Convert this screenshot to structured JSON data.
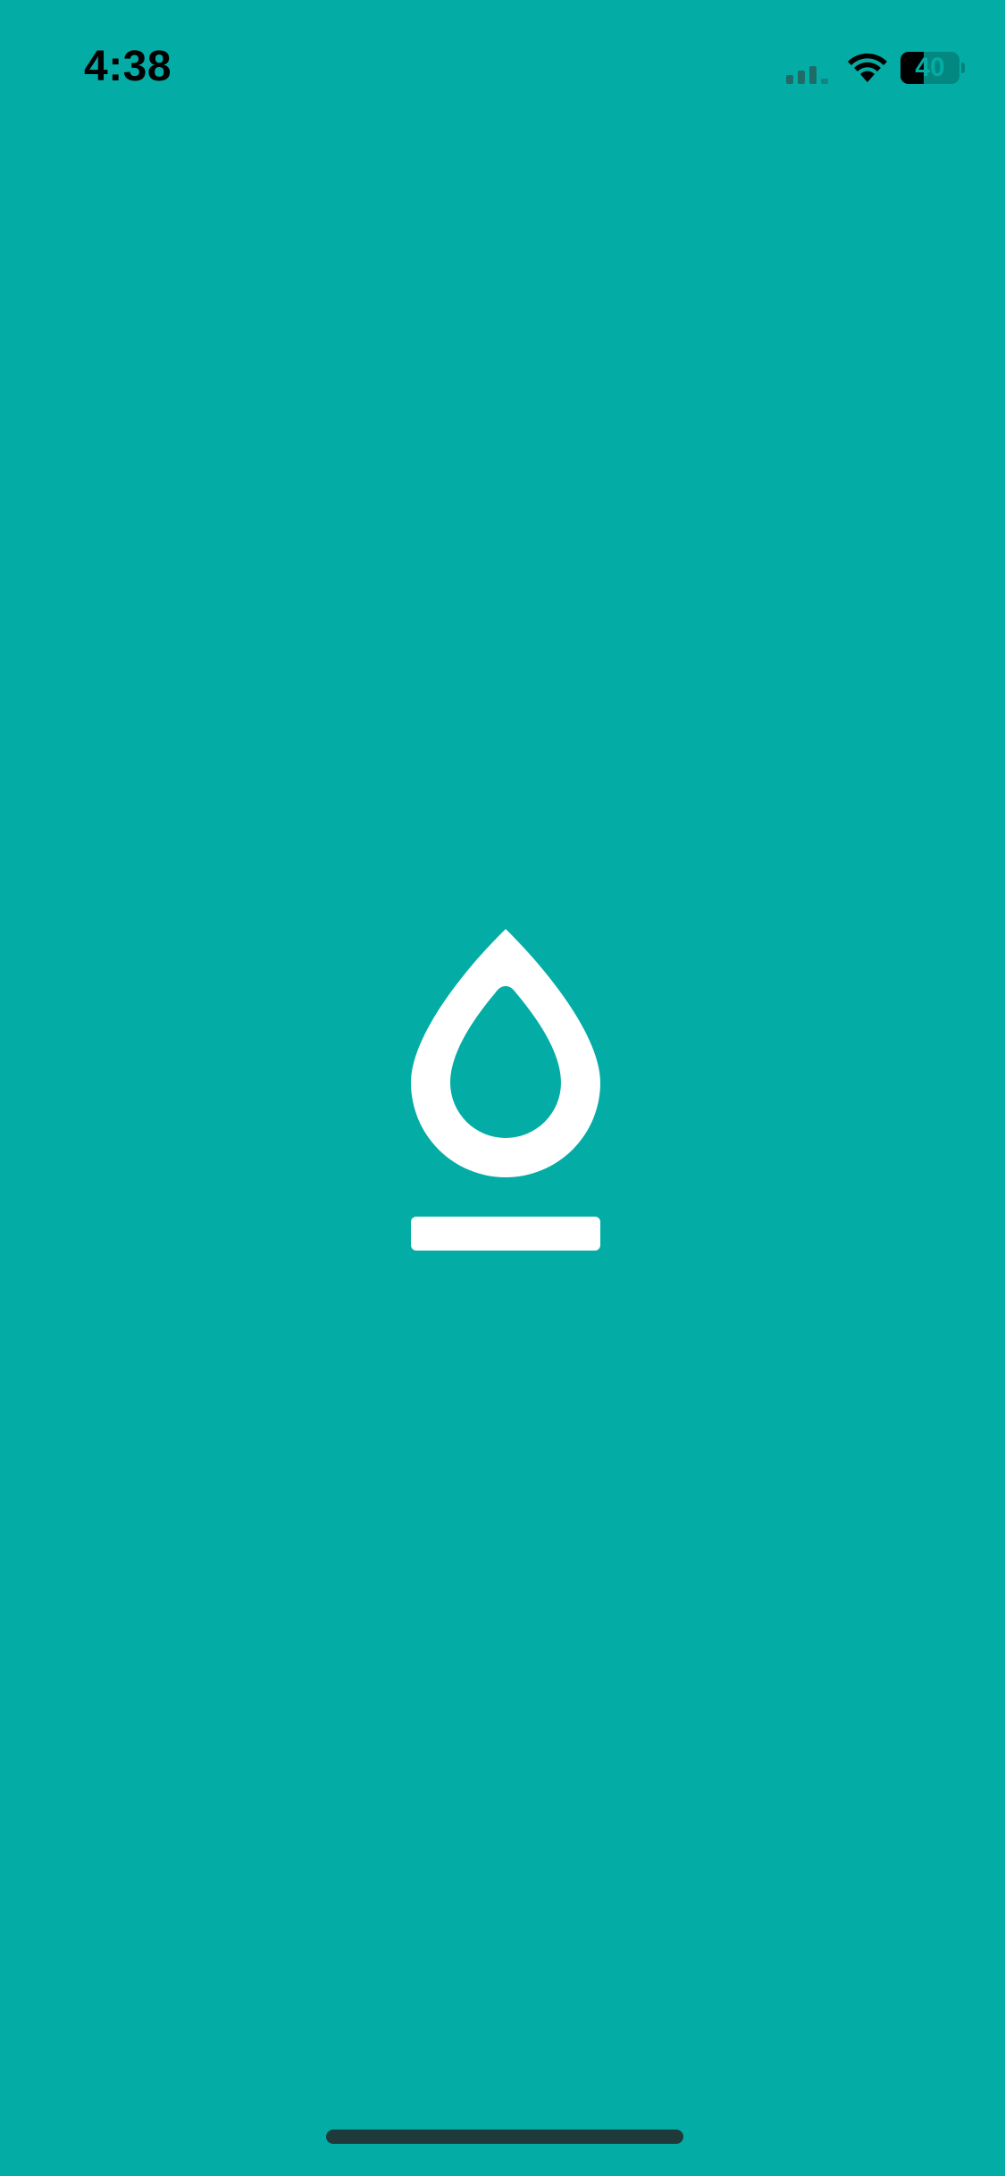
{
  "status_bar": {
    "time": "4:38",
    "battery_level": "40",
    "battery_fraction": 0.4
  },
  "icons": {
    "signal": "cellular-signal-icon",
    "wifi": "wifi-icon",
    "battery": "battery-icon",
    "logo": "water-drop-logo-icon"
  },
  "colors": {
    "background": "#03ADA6",
    "logo": "#FFFFFF",
    "home_indicator": "#1F3A3A"
  }
}
